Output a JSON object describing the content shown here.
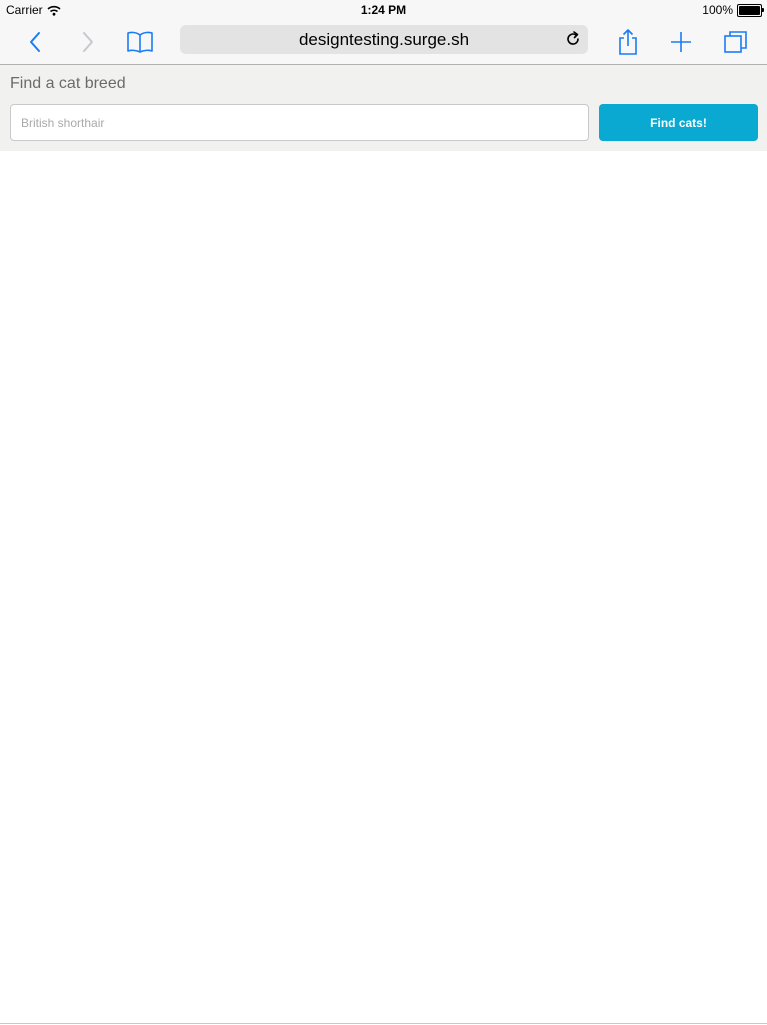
{
  "status_bar": {
    "carrier": "Carrier",
    "time": "1:24 PM",
    "battery": "100%"
  },
  "toolbar": {
    "url": "designtesting.surge.sh",
    "icons": [
      "back-icon",
      "forward-icon",
      "bookmarks-icon",
      "reload-icon",
      "share-icon",
      "new-tab-icon",
      "tabs-icon"
    ],
    "accent": "#1a7cf5"
  },
  "search": {
    "heading": "Find a cat breed",
    "placeholder": "British shorthair",
    "value": "",
    "button_label": "Find cats!",
    "button_color": "#09a9d1"
  }
}
